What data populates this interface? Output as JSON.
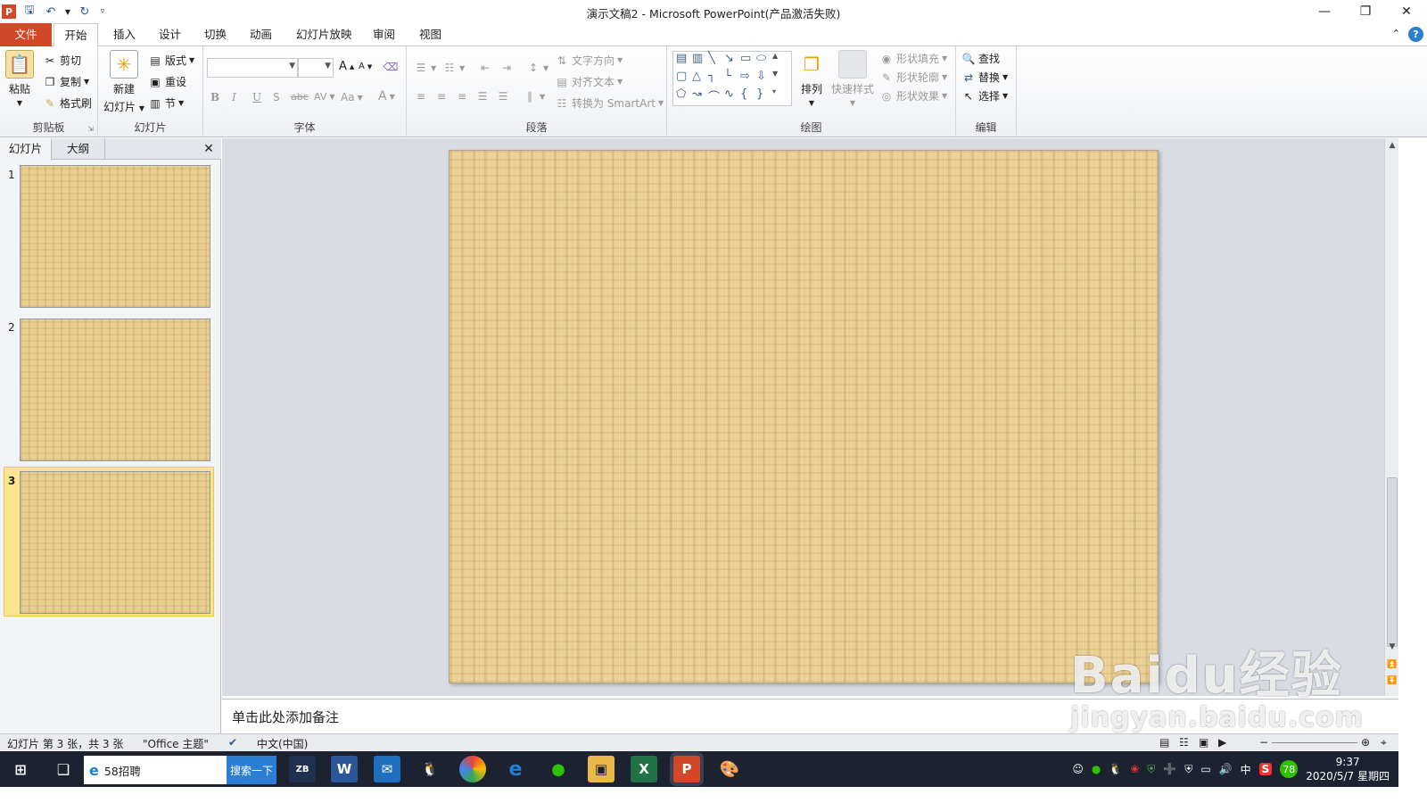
{
  "window": {
    "title": "演示文稿2 - Microsoft PowerPoint(产品激活失败)"
  },
  "tabs": [
    "文件",
    "开始",
    "插入",
    "设计",
    "切换",
    "动画",
    "幻灯片放映",
    "审阅",
    "视图"
  ],
  "ribbon": {
    "clipboard": {
      "paste": "粘贴",
      "cut": "剪切",
      "copy": "复制",
      "format_painter": "格式刷",
      "label": "剪贴板"
    },
    "slides": {
      "new_slide_1": "新建",
      "new_slide_2": "幻灯片",
      "layout": "版式",
      "reset": "重设",
      "section": "节",
      "label": "幻灯片"
    },
    "font": {
      "label": "字体",
      "bold": "B",
      "italic": "I",
      "underline": "U",
      "shadow": "S",
      "strike": "abc",
      "spacing": "AV",
      "case": "Aa",
      "color": "A",
      "grow": "A",
      "shrink": "A"
    },
    "paragraph": {
      "text_direction": "文字方向",
      "align_text": "对齐文本",
      "smartart": "转换为 SmartArt",
      "label": "段落"
    },
    "drawing": {
      "arrange": "排列",
      "quick_styles": "快速样式",
      "shape_fill": "形状填充",
      "shape_outline": "形状轮廓",
      "shape_effects": "形状效果",
      "label": "绘图"
    },
    "editing": {
      "find": "查找",
      "replace": "替换",
      "select": "选择",
      "label": "编辑"
    }
  },
  "panel": {
    "tab_slides": "幻灯片",
    "tab_outline": "大纲",
    "slides": [
      "1",
      "2",
      "3"
    ],
    "selected": 3
  },
  "notes": {
    "placeholder": "单击此处添加备注"
  },
  "status": {
    "slide_info": "幻灯片 第 3 张，共 3 张",
    "theme": "\"Office 主题\"",
    "language": "中文(中国)"
  },
  "taskbar": {
    "search_text": "58招聘",
    "search_button": "搜索一下",
    "time": "9:37",
    "date": "2020/5/7 星期四",
    "ime": "中",
    "badge": "78"
  },
  "watermark": {
    "main": "Baidu经验",
    "sub": "jingyan.baidu.com"
  },
  "colors": {
    "file_tab": "#d24726",
    "selection": "#fce58f",
    "taskbar": "#1c2230",
    "slide_bg": "#ead095"
  }
}
